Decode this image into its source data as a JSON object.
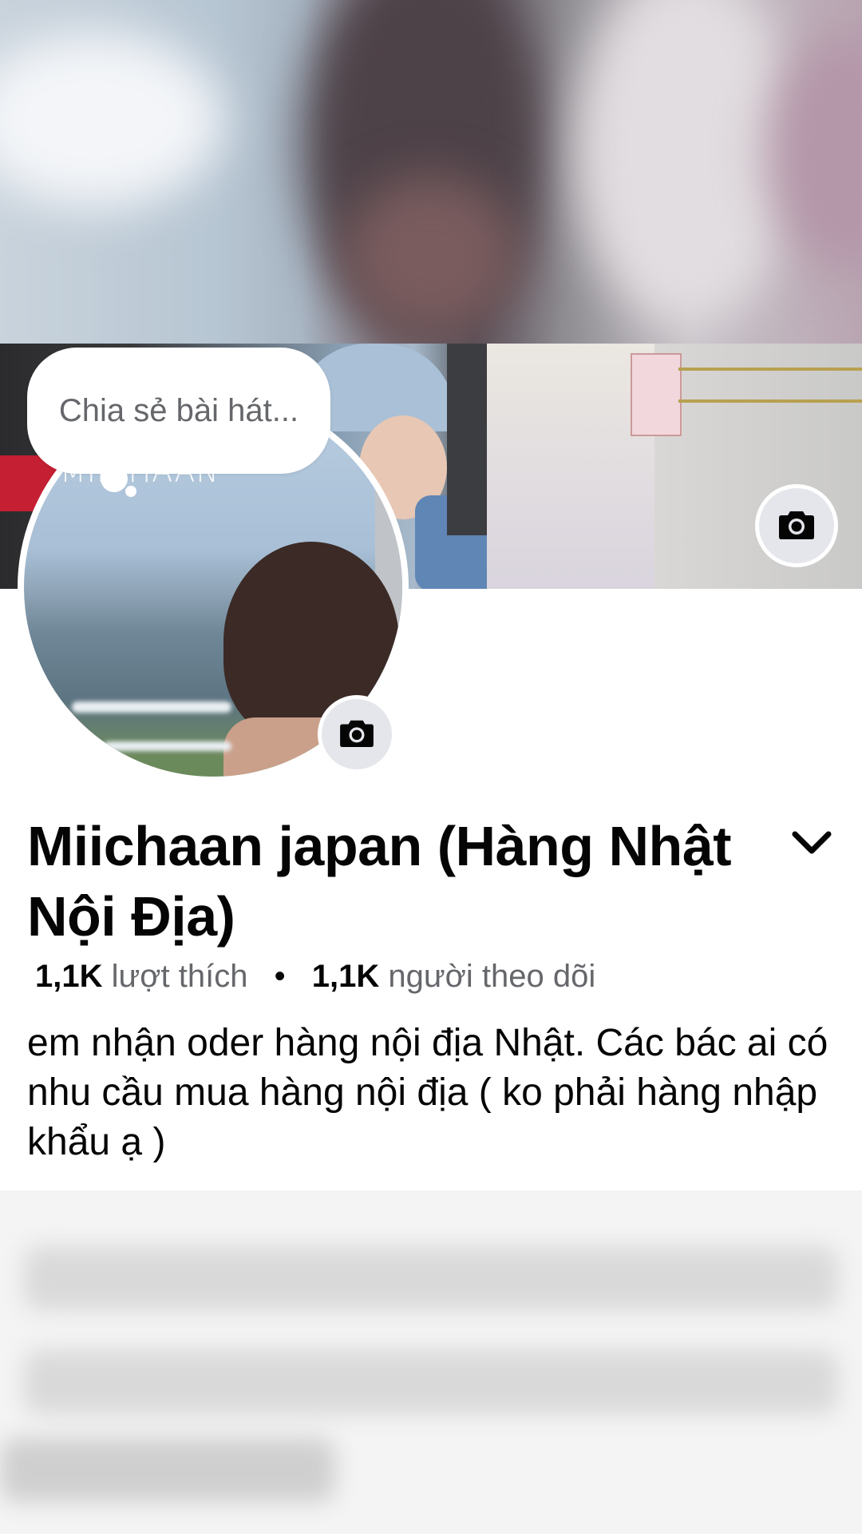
{
  "note": {
    "placeholder": "Chia sẻ bài hát..."
  },
  "avatar": {
    "watermark": "MIICHAAN"
  },
  "profile": {
    "name": "Miichaan japan  (Hàng Nhật Nội Địa)",
    "likes_count": "1,1K",
    "likes_label": "lượt thích",
    "separator": "•",
    "followers_count": "1,1K",
    "followers_label": "người theo dõi",
    "bio": "em nhận oder hàng nội địa Nhật. Các bác ai có nhu cầu mua hàng nội địa ( ko phải hàng nhập khẩu ạ )"
  },
  "icons": {
    "cover_camera": "camera-icon",
    "avatar_camera": "camera-icon",
    "name_dropdown": "chevron-down-icon"
  },
  "colors": {
    "primary_text": "#050505",
    "secondary_text": "#65676b",
    "button_bg": "#e4e6eb"
  }
}
